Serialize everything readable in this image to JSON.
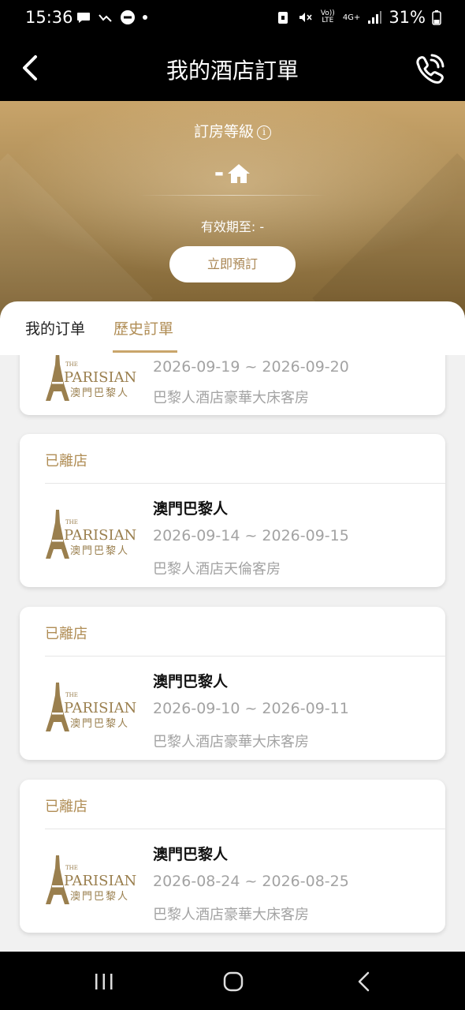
{
  "status_bar": {
    "time": "15:36",
    "battery": "31%",
    "network_volte": "Vo)) LTE",
    "network_type": "4G+"
  },
  "header": {
    "title": "我的酒店訂單",
    "back_icon": "chevron-left-icon",
    "call_icon": "phone-call-icon"
  },
  "hero": {
    "tier_label": "訂房等級",
    "tier_value": "-",
    "valid_until": "有效期至: -",
    "book_now": "立即預訂"
  },
  "tabs": [
    {
      "label": "我的订单",
      "active": false
    },
    {
      "label": "歷史訂單",
      "active": true
    }
  ],
  "orders": [
    {
      "status": "",
      "hotel": "",
      "dates": "2026-09-19 ~ 2026-09-20",
      "room": "巴黎人酒店豪華大床客房",
      "partial": true
    },
    {
      "status": "已離店",
      "hotel": "澳門巴黎人",
      "dates": "2026-09-14 ~ 2026-09-15",
      "room": "巴黎人酒店天倫客房"
    },
    {
      "status": "已離店",
      "hotel": "澳門巴黎人",
      "dates": "2026-09-10 ~ 2026-09-11",
      "room": "巴黎人酒店豪華大床客房"
    },
    {
      "status": "已離店",
      "hotel": "澳門巴黎人",
      "dates": "2026-08-24 ~ 2026-08-25",
      "room": "巴黎人酒店豪華大床客房"
    }
  ],
  "logo": {
    "the": "THE",
    "parisian": "PARISIAN",
    "chinese": "澳門巴黎人"
  },
  "colors": {
    "accent_gold": "#b08d55",
    "hero_gold": "#a98a55",
    "muted_text": "#a3a3a3"
  }
}
